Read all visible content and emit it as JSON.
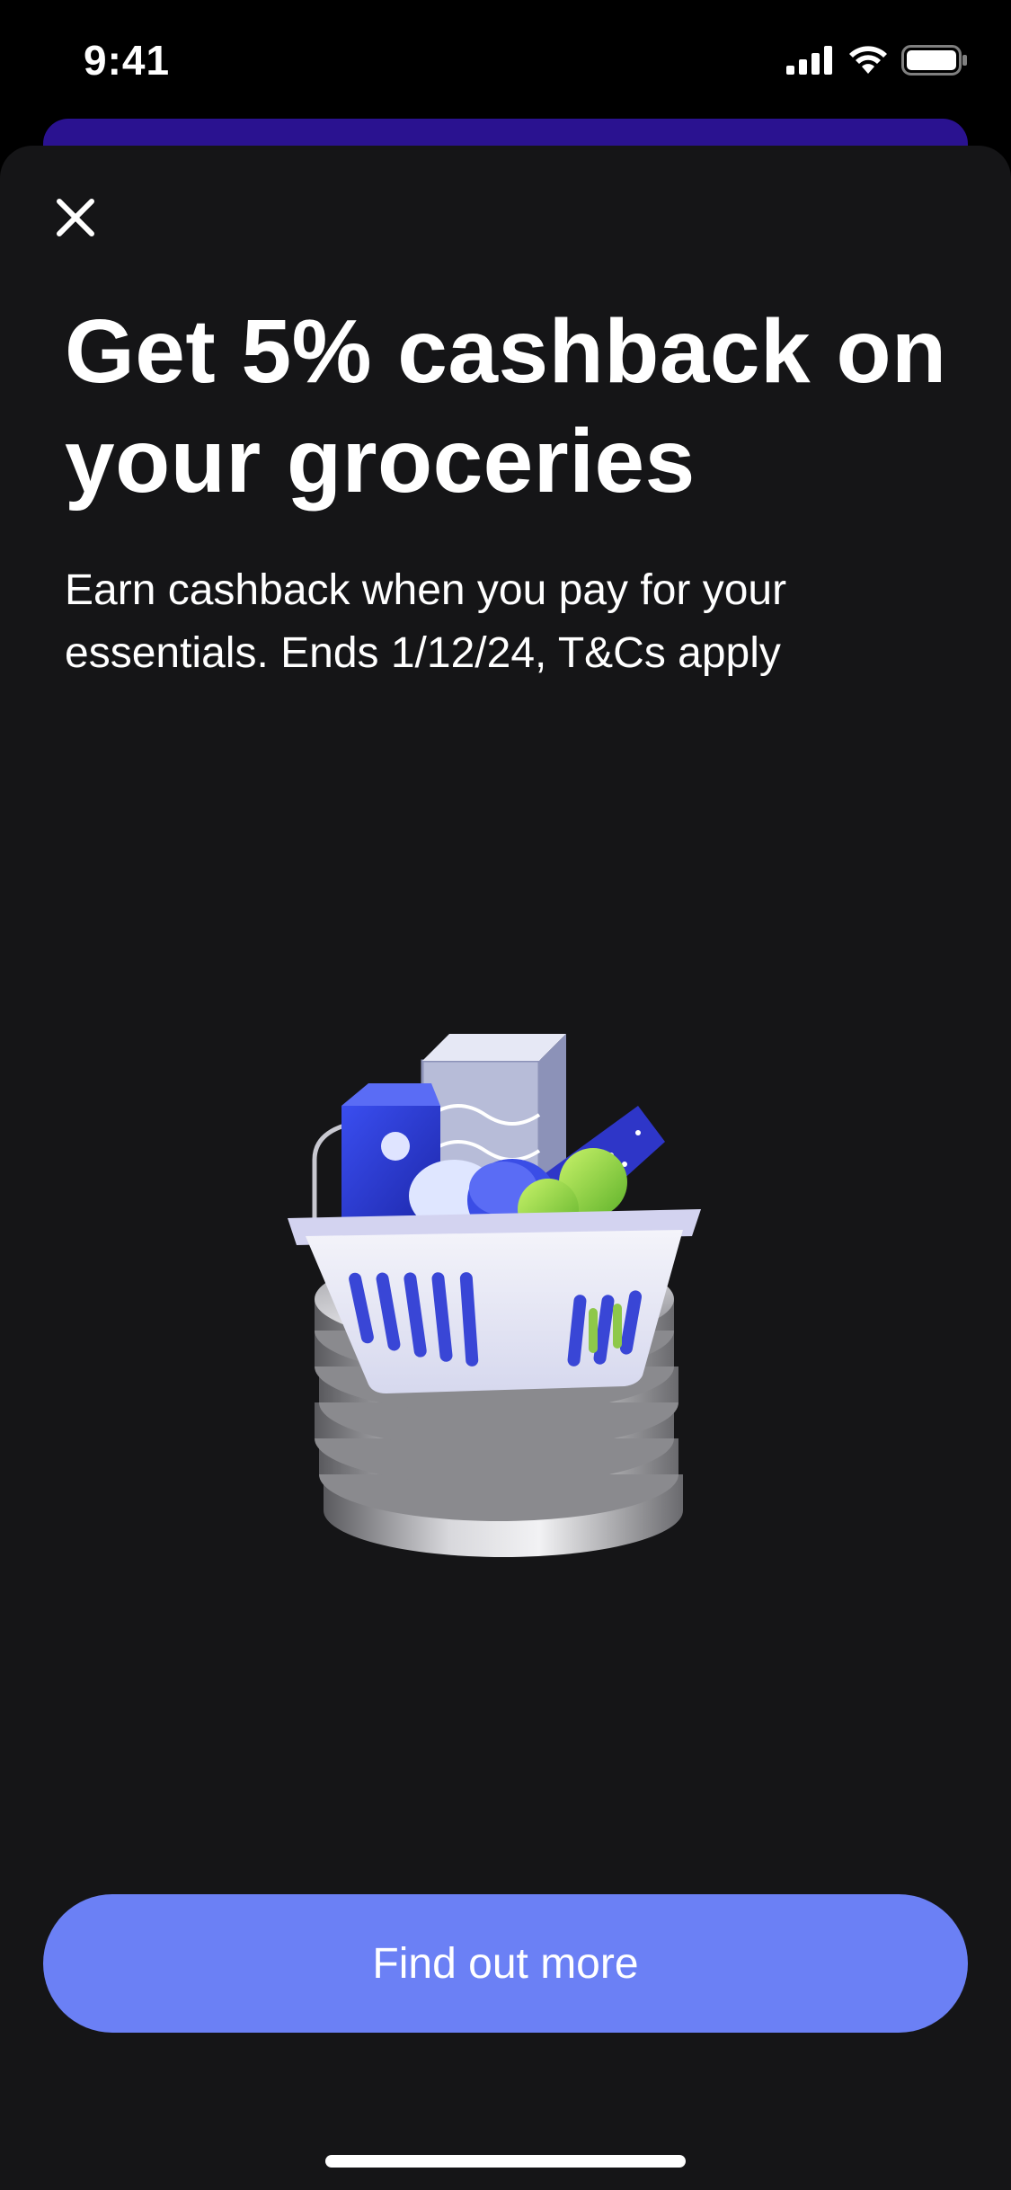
{
  "status_bar": {
    "time": "9:41"
  },
  "promo": {
    "title": "Get 5% cashback on your groceries",
    "description": "Earn cashback when you pay for your essentials. Ends 1/12/24, T&Cs apply"
  },
  "actions": {
    "primary_label": "Find out more"
  },
  "icons": {
    "close": "close-icon",
    "signal": "cellular-signal-icon",
    "wifi": "wifi-icon",
    "battery": "battery-icon"
  },
  "colors": {
    "background": "#151517",
    "accent_button": "#6b80f5",
    "behind_card": "#2a1290"
  }
}
